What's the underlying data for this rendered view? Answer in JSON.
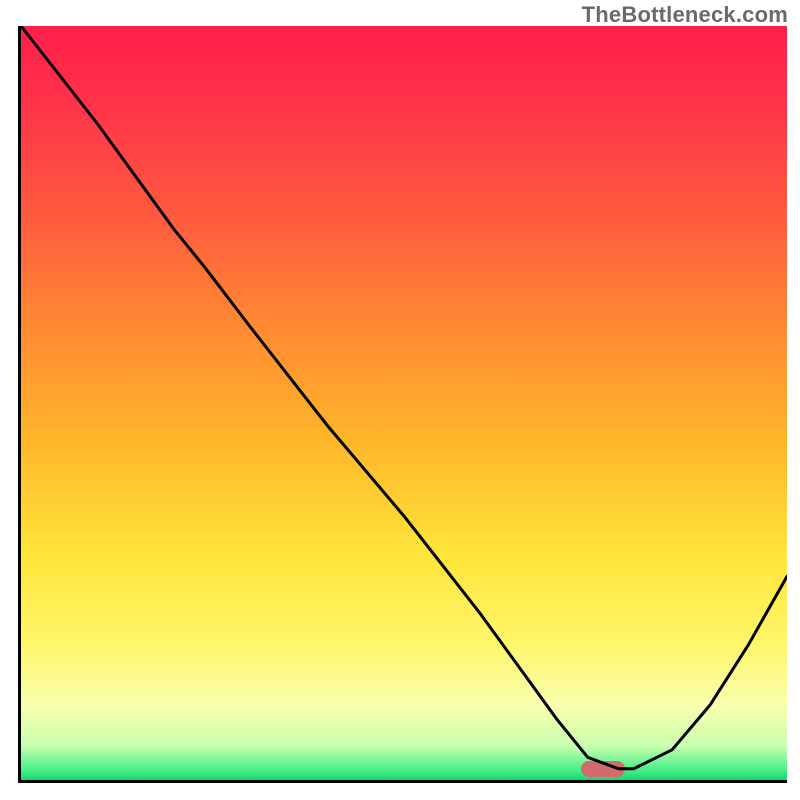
{
  "watermark": "TheBottleneck.com",
  "chart_data": {
    "type": "line",
    "title": "",
    "xlabel": "",
    "ylabel": "",
    "xlim": [
      0,
      100
    ],
    "ylim": [
      0,
      100
    ],
    "x": [
      0,
      10,
      20,
      24,
      30,
      40,
      50,
      60,
      65,
      70,
      74,
      78,
      80,
      85,
      90,
      95,
      100
    ],
    "values": [
      100,
      87,
      73,
      68,
      60,
      47,
      35,
      22,
      15,
      8,
      3,
      1.5,
      1.5,
      4,
      10,
      18,
      27
    ],
    "gradient_stops": [
      {
        "pos": 0.0,
        "color": "#ff1f4a"
      },
      {
        "pos": 0.1,
        "color": "#ff3249"
      },
      {
        "pos": 0.25,
        "color": "#ff5a3f"
      },
      {
        "pos": 0.4,
        "color": "#ff8a33"
      },
      {
        "pos": 0.55,
        "color": "#ffb62a"
      },
      {
        "pos": 0.7,
        "color": "#ffe43a"
      },
      {
        "pos": 0.82,
        "color": "#fff66a"
      },
      {
        "pos": 0.9,
        "color": "#f8ffae"
      },
      {
        "pos": 0.955,
        "color": "#c9ffb0"
      },
      {
        "pos": 0.985,
        "color": "#4df08a"
      },
      {
        "pos": 1.0,
        "color": "#17d66f"
      }
    ],
    "marker": {
      "x": 76,
      "y": 1.5,
      "color": "#d36a6e"
    }
  }
}
